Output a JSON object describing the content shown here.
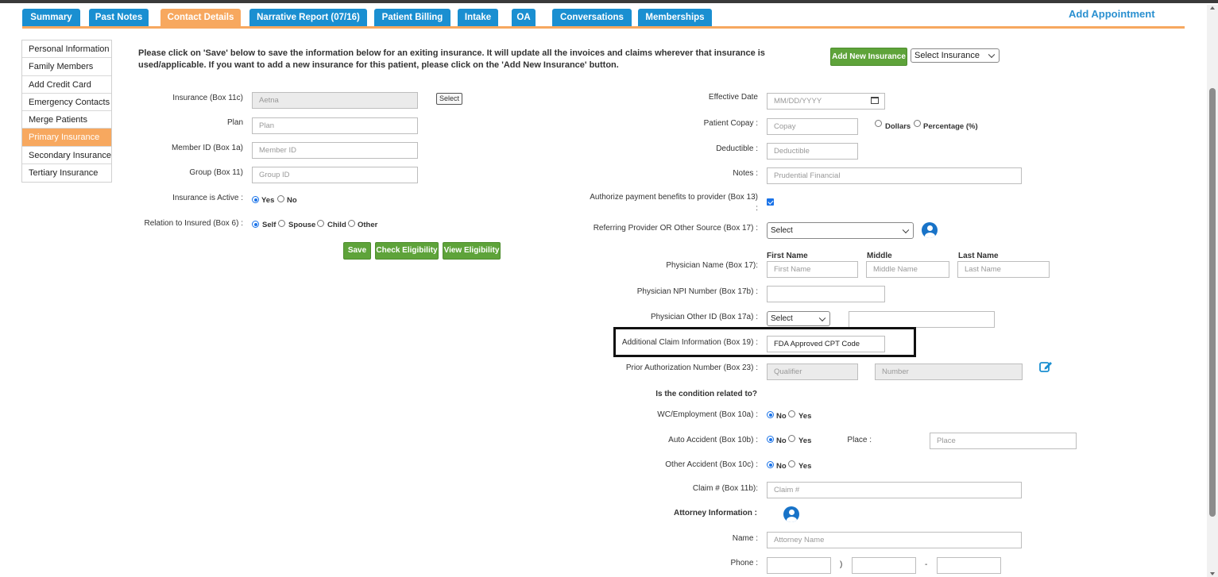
{
  "tabs": [
    {
      "label": "Summary"
    },
    {
      "label": "Past Notes"
    },
    {
      "label": "Contact Details"
    },
    {
      "label": "Narrative Report (07/16)"
    },
    {
      "label": "Patient Billing"
    },
    {
      "label": "Intake"
    },
    {
      "label": "OA"
    },
    {
      "label": "Conversations"
    },
    {
      "label": "Memberships"
    }
  ],
  "add_appointment": "Add Appointment",
  "sidebar": {
    "items": [
      {
        "label": "Personal Information"
      },
      {
        "label": "Family Members"
      },
      {
        "label": "Add Credit Card"
      },
      {
        "label": "Emergency Contacts"
      },
      {
        "label": "Merge Patients"
      },
      {
        "label": "Primary Insurance"
      },
      {
        "label": "Secondary Insurance"
      },
      {
        "label": "Tertiary Insurance"
      }
    ]
  },
  "intro": "Please click on 'Save' below to save the information below for an exiting insurance. It will update all the invoices and claims wherever that insurance is used/applicable. If you want to add a new insurance for this patient, please click on the 'Add New Insurance' button.",
  "top_actions": {
    "add_new_insurance": "Add New Insurance",
    "select_insurance": "Select Insurance"
  },
  "left_form": {
    "insurance_label": "Insurance (Box 11c)",
    "insurance_value": "Aetna",
    "select_button": "Select",
    "plan_label": "Plan",
    "plan_placeholder": "Plan",
    "member_label": "Member ID (Box 1a)",
    "member_placeholder": "Member ID",
    "group_label": "Group (Box 11)",
    "group_placeholder": "Group ID",
    "active_label": "Insurance is Active :",
    "active_yes": "Yes",
    "active_no": "No",
    "relation_label": "Relation to Insured (Box 6) :",
    "rel_self": "Self",
    "rel_spouse": "Spouse",
    "rel_child": "Child",
    "rel_other": "Other",
    "save": "Save",
    "check_eligibility": "Check Eligibility",
    "view_eligibility": "View Eligibility"
  },
  "right_form": {
    "effective_label": "Effective Date",
    "effective_placeholder": "MM/DD/YYYY",
    "copay_label": "Patient Copay :",
    "copay_placeholder": "Copay",
    "dollars": "Dollars",
    "percentage": "Percentage (%)",
    "deductible_label": "Deductible :",
    "deductible_placeholder": "Deductible",
    "notes_label": "Notes :",
    "notes_value": "Prudential Financial",
    "authorize_label": "Authorize payment benefits to provider (Box 13)",
    "authorize_colon": ":",
    "referring_label": "Referring Provider OR Other Source (Box 17) :",
    "referring_value": "Select",
    "first_name_hdr": "First Name",
    "middle_hdr": "Middle",
    "last_name_hdr": "Last Name",
    "physician_name_label": "Physician Name (Box 17):",
    "first_name_ph": "First Name",
    "middle_ph": "Middle Name",
    "last_name_ph": "Last Name",
    "npi_label": "Physician NPI Number (Box 17b) :",
    "other_id_label": "Physician Other ID (Box 17a) :",
    "other_id_value": "Select",
    "additional_label": "Additional Claim Information (Box 19) :",
    "additional_value": "FDA Approved CPT Code",
    "prior_auth_label": "Prior Authorization Number (Box 23) :",
    "qualifier_ph": "Qualifier",
    "number_ph": "Number",
    "condition_header": "Is the condition related to?",
    "wc_label": "WC/Employment (Box 10a) :",
    "auto_label": "Auto Accident (Box 10b) :",
    "other_acc_label": "Other Accident (Box 10c) :",
    "no": "No",
    "yes": "Yes",
    "place_label": "Place :",
    "place_ph": "Place",
    "claim_label": "Claim # (Box 11b):",
    "claim_ph": "Claim #",
    "attorney_header": "Attorney Information :",
    "name_label": "Name :",
    "name_ph": "Attorney Name",
    "phone_label": "Phone :",
    "paren_close": ")",
    "dash": "-"
  }
}
